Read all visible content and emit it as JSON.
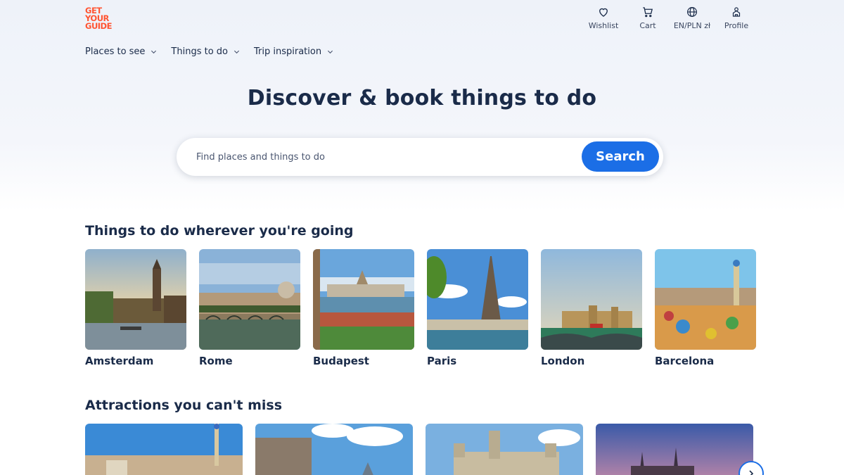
{
  "brand": {
    "logo_lines": [
      "GET",
      "YOUR",
      "GUIDE"
    ]
  },
  "top_actions": [
    {
      "label": "Wishlist",
      "icon": "heart-icon"
    },
    {
      "label": "Cart",
      "icon": "cart-icon"
    },
    {
      "label": "EN/PLN zł",
      "icon": "globe-icon"
    },
    {
      "label": "Profile",
      "icon": "profile-icon"
    }
  ],
  "nav": [
    {
      "label": "Places to see"
    },
    {
      "label": "Things to do"
    },
    {
      "label": "Trip inspiration"
    }
  ],
  "hero": {
    "title": "Discover & book things to do",
    "search_placeholder": "Find places and things to do",
    "search_button": "Search"
  },
  "destinations": {
    "title": "Things to do wherever you're going",
    "items": [
      {
        "name": "Amsterdam"
      },
      {
        "name": "Rome"
      },
      {
        "name": "Budapest"
      },
      {
        "name": "Paris"
      },
      {
        "name": "London"
      },
      {
        "name": "Barcelona"
      }
    ]
  },
  "attractions": {
    "title": "Attractions you can't miss"
  },
  "colors": {
    "brand": "#ff5533",
    "accent": "#1b6ee6",
    "text": "#1a2b49"
  }
}
